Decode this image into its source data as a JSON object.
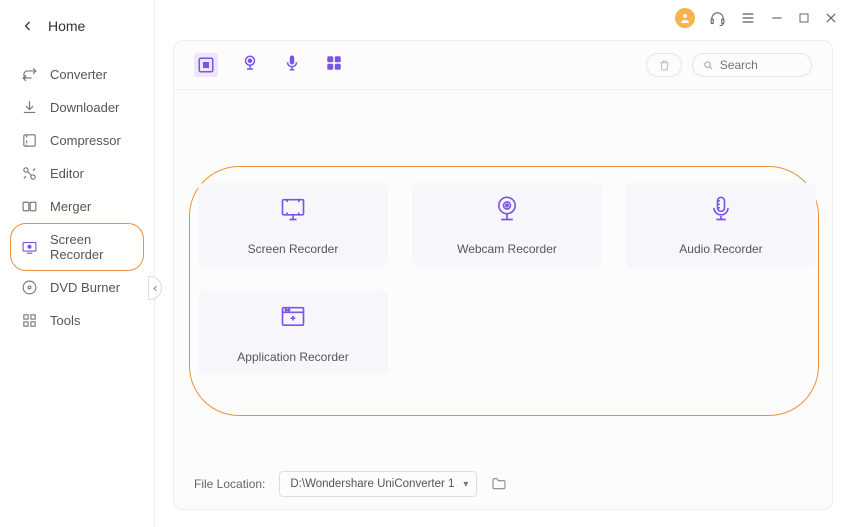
{
  "window": {
    "avatar_initial": ""
  },
  "home": {
    "label": "Home"
  },
  "sidebar": {
    "items": [
      {
        "label": "Converter"
      },
      {
        "label": "Downloader"
      },
      {
        "label": "Compressor"
      },
      {
        "label": "Editor"
      },
      {
        "label": "Merger"
      },
      {
        "label": "Screen Recorder"
      },
      {
        "label": "DVD Burner"
      },
      {
        "label": "Tools"
      }
    ],
    "active_index": 5
  },
  "search": {
    "placeholder": "Search"
  },
  "tiles": [
    {
      "label": "Screen Recorder"
    },
    {
      "label": "Webcam Recorder"
    },
    {
      "label": "Audio Recorder"
    },
    {
      "label": "Application Recorder"
    }
  ],
  "footer": {
    "label": "File Location:",
    "path": "D:\\Wondershare UniConverter 1"
  }
}
